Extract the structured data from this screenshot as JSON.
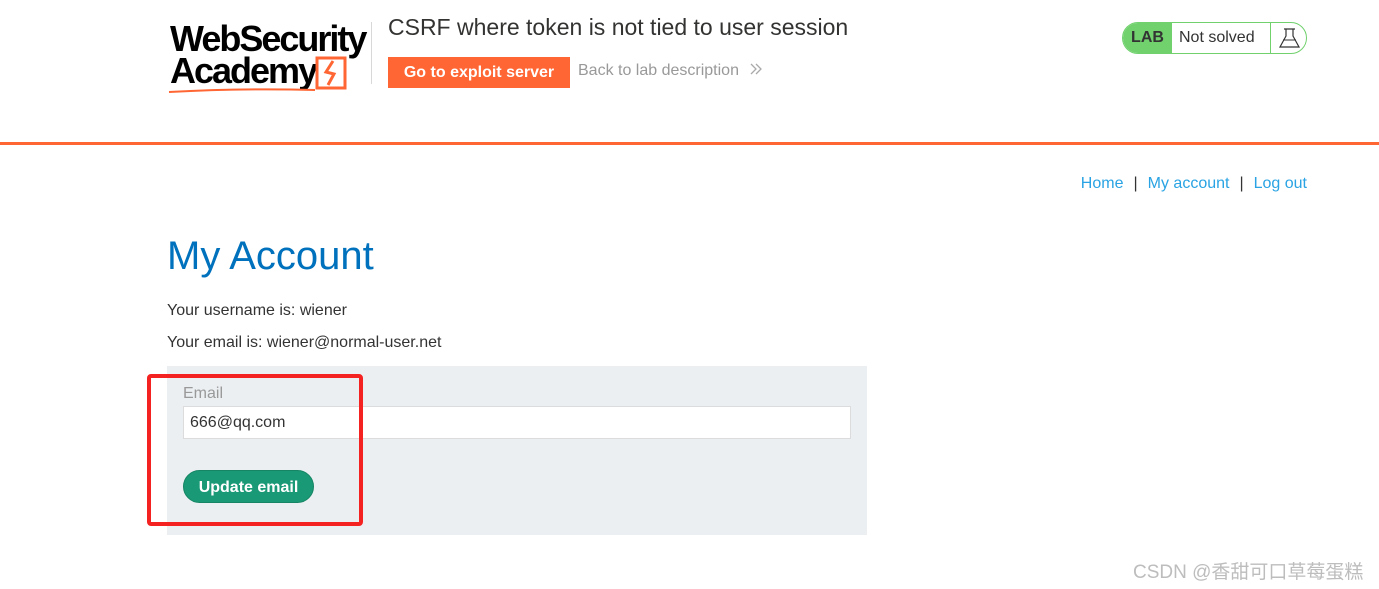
{
  "header": {
    "logo": {
      "line1": "WebSecurity",
      "line2": "Academy"
    },
    "title": "CSRF where token is not tied to user session",
    "exploit_button": "Go to exploit server",
    "back_link": "Back to lab description",
    "back_link_icon": "double-chevron-right-icon",
    "lab_status": {
      "tag": "LAB",
      "state": "Not solved",
      "icon": "flask-icon"
    }
  },
  "nav": {
    "items": [
      {
        "label": "Home"
      },
      {
        "label": "My account"
      },
      {
        "label": "Log out"
      }
    ],
    "separator": "|"
  },
  "main": {
    "title": "My Account",
    "username_text": "Your username is: wiener",
    "email_text": "Your email is: wiener@normal-user.net",
    "form": {
      "email_label": "Email",
      "email_value": "666@qq.com",
      "submit_label": "Update email"
    }
  },
  "watermark": "CSDN @香甜可口草莓蛋糕",
  "colors": {
    "accent_orange": "#ff6633",
    "lab_green": "#70d16d",
    "title_blue": "#0071bc",
    "link_blue": "#29a3e3",
    "button_green": "#1a9977",
    "highlight_red": "#f52222",
    "form_bg": "#ebeff2"
  }
}
